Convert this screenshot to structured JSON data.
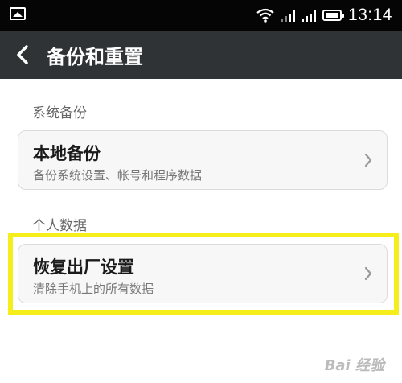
{
  "status_bar": {
    "time": "13:14",
    "icons": [
      "picture-icon",
      "wifi-icon",
      "signal-icon",
      "signal-icon",
      "battery-icon"
    ]
  },
  "title_bar": {
    "back_icon": "chevron-left-icon",
    "title": "备份和重置"
  },
  "sections": [
    {
      "header": "系统备份",
      "items": [
        {
          "title": "本地备份",
          "subtitle": "备份系统设置、帐号和程序数据",
          "icon": "chevron-right-icon"
        }
      ]
    },
    {
      "header": "个人数据",
      "items": [
        {
          "title": "恢复出厂设置",
          "subtitle": "清除手机上的所有数据",
          "icon": "chevron-right-icon"
        }
      ]
    }
  ],
  "highlight_color": "#f5ee1b",
  "watermark": "Bai 经验"
}
